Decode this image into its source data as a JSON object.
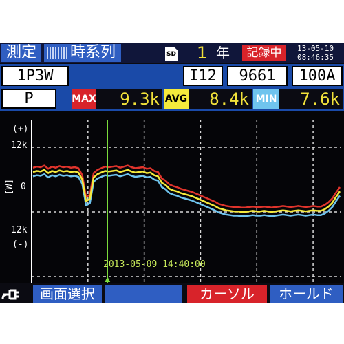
{
  "header": {
    "tab_measure": "測定",
    "tab_timeseries": "時系列",
    "sd_label": "SD",
    "period_value": "1",
    "period_unit": "年",
    "recording_badge": "記録中",
    "date": "13-05-10",
    "time": "08:46:35"
  },
  "settings": {
    "wiring": "1P3W",
    "clamp": "I12",
    "clamp_model": "9661",
    "range": "100A",
    "parameter": "P"
  },
  "stats": {
    "max_label": "MAX",
    "max_value": "9.3k",
    "avg_label": "AVG",
    "avg_value": "8.4k",
    "min_label": "MIN",
    "min_value": "7.6k"
  },
  "plot": {
    "y_top_sign": "(+)",
    "y_top_tick": "12k",
    "y_unit": "[W]",
    "y_zero_tick": "0",
    "y_bottom_tick": "12k",
    "y_bottom_sign": "(-)",
    "cursor_timestamp": "2013-05-09 14:40:00",
    "cursor_position_fraction": 0.245,
    "colors": {
      "max": "#e0342c",
      "avg": "#f5ea3c",
      "min": "#6fc4ee",
      "cursor": "#7bdc3c",
      "grid": "#d8d8d8"
    }
  },
  "chart_data": {
    "type": "line",
    "ylim": [
      -12000,
      12000
    ],
    "y_ticks": [
      "12k",
      "0",
      "12k"
    ],
    "series": [
      {
        "name": "MAX",
        "values": [
          8200,
          8400,
          8300,
          8600,
          8000,
          8400,
          8200,
          8500,
          8300,
          8400,
          8200,
          8300,
          8100,
          6800,
          2800,
          3200,
          7200,
          7800,
          8100,
          8400,
          8300,
          8400,
          8500,
          8200,
          8400,
          8600,
          8300,
          8100,
          8200,
          8300,
          8000,
          8100,
          7600,
          7400,
          6200,
          5800,
          5100,
          4800,
          4600,
          4300,
          4100,
          3900,
          3700,
          3400,
          3100,
          2800,
          2500,
          2200,
          1900,
          1500,
          1300,
          1100,
          1000,
          900,
          900,
          800,
          800,
          900,
          1000,
          900,
          900,
          1000,
          900,
          800,
          900,
          1000,
          1100,
          1000,
          900,
          1000,
          1100,
          1000,
          900,
          1000,
          1100,
          1000,
          1000,
          1300,
          1800,
          2500,
          3600,
          4600
        ]
      },
      {
        "name": "AVG",
        "values": [
          7400,
          7600,
          7500,
          7800,
          7200,
          7600,
          7400,
          7700,
          7500,
          7600,
          7400,
          7500,
          7300,
          6000,
          2000,
          2400,
          6400,
          7000,
          7300,
          7600,
          7500,
          7600,
          7700,
          7400,
          7600,
          7800,
          7500,
          7300,
          7400,
          7500,
          7200,
          7300,
          6800,
          6600,
          5400,
          5000,
          4300,
          4000,
          3800,
          3500,
          3300,
          3100,
          2900,
          2600,
          2300,
          2000,
          1700,
          1400,
          1100,
          700,
          500,
          300,
          200,
          100,
          100,
          0,
          0,
          100,
          200,
          100,
          100,
          200,
          100,
          0,
          100,
          200,
          300,
          200,
          100,
          200,
          300,
          200,
          100,
          200,
          300,
          200,
          200,
          500,
          1000,
          1700,
          2800,
          3800
        ]
      },
      {
        "name": "MIN",
        "values": [
          6600,
          6800,
          6700,
          7000,
          6400,
          6800,
          6600,
          6900,
          6700,
          6800,
          6600,
          6700,
          6500,
          5200,
          1200,
          1600,
          5600,
          6200,
          6500,
          6800,
          6700,
          6800,
          6900,
          6600,
          6800,
          7000,
          6700,
          6500,
          6600,
          6700,
          6400,
          6500,
          6000,
          5800,
          4600,
          4200,
          3500,
          3200,
          3000,
          2700,
          2500,
          2300,
          2100,
          1800,
          1500,
          1200,
          900,
          600,
          300,
          -100,
          -300,
          -500,
          -600,
          -700,
          -700,
          -800,
          -800,
          -700,
          -600,
          -700,
          -700,
          -600,
          -700,
          -800,
          -700,
          -600,
          -500,
          -600,
          -700,
          -600,
          -500,
          -600,
          -700,
          -600,
          -500,
          -600,
          -600,
          -300,
          200,
          900,
          2000,
          3000
        ]
      }
    ]
  },
  "footer": {
    "screen_select": "画面選択",
    "blank_button": "",
    "cursor_button": "カーソル",
    "hold_button": "ホールド"
  }
}
